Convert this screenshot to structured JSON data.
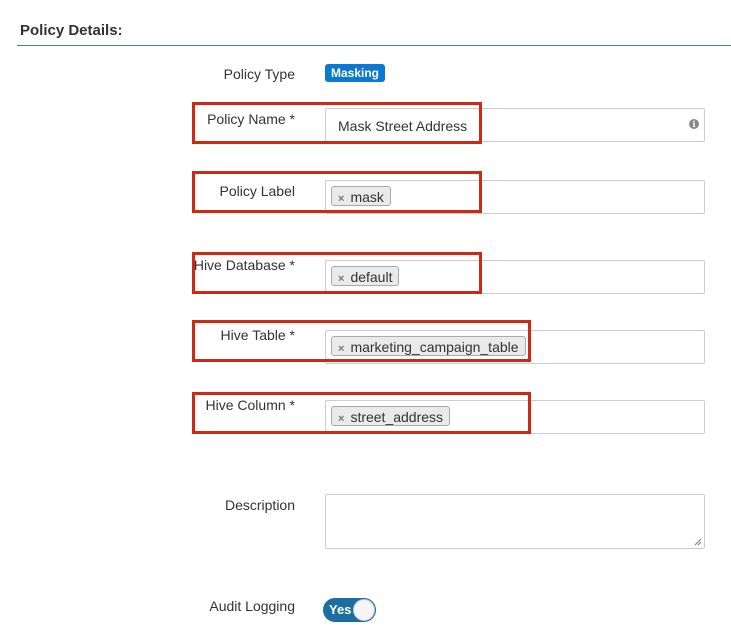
{
  "section": {
    "title": "Policy Details:"
  },
  "policy_type": {
    "label": "Policy Type",
    "value": "Masking"
  },
  "policy_name": {
    "label": "Policy Name *",
    "value": "Mask Street Address",
    "info_icon": "info-icon"
  },
  "policy_label": {
    "label": "Policy Label",
    "tag": "mask"
  },
  "hive_database": {
    "label": "Hive Database *",
    "tag": "default"
  },
  "hive_table": {
    "label": "Hive Table *",
    "tag": "marketing_campaign_table"
  },
  "hive_column": {
    "label": "Hive Column *",
    "tag": "street_address"
  },
  "description": {
    "label": "Description",
    "value": ""
  },
  "audit_logging": {
    "label": "Audit Logging",
    "toggle_text": "Yes",
    "enabled": true
  },
  "colors": {
    "accent": "#0b78d1",
    "highlight": "#cc2a14",
    "toggle": "#1d6ea0",
    "section_rule": "#3f7f9f"
  },
  "icons": {
    "tag_remove": "×",
    "info": "i"
  }
}
